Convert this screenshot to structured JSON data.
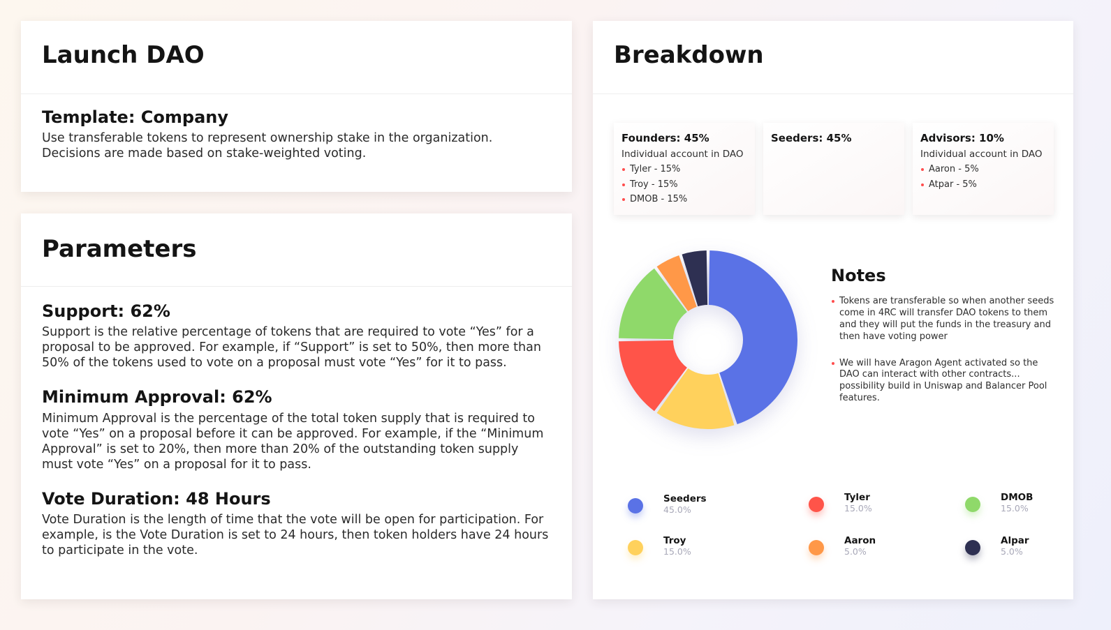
{
  "launch": {
    "title": "Launch DAO",
    "template_title": "Template: Company",
    "template_desc": "Use transferable tokens to represent ownership stake in the organization. Decisions are made based on stake-weighted voting."
  },
  "parameters": {
    "title": "Parameters",
    "items": [
      {
        "title": "Support: 62%",
        "desc": "Support is the relative percentage of tokens that are required to vote “Yes” for a proposal to be approved. For example, if “Support” is set to 50%, then more than 50% of the tokens used to vote on a proposal must vote “Yes” for it to pass."
      },
      {
        "title": "Minimum Approval: 62%",
        "desc": "Minimum Approval is the percentage of the total token supply that is required  to vote “Yes” on a proposal before it can be approved. For example, if the “Minimum Approval” is set to 20%, then more than 20% of the outstanding token supply must vote “Yes” on a proposal for it to pass."
      },
      {
        "title": "Vote Duration: 48 Hours",
        "desc": "Vote Duration is the length of time that the vote will be open for participation. For example, is the Vote Duration is set to 24 hours, then token holders have 24 hours to participate in the vote."
      }
    ]
  },
  "breakdown": {
    "title": "Breakdown",
    "allocations": [
      {
        "title": "Founders: 45%",
        "subtitle": "Individual account in DAO",
        "items": [
          "Tyler - 15%",
          "Troy - 15%",
          "DMOB - 15%"
        ]
      },
      {
        "title": "Seeders: 45%",
        "subtitle": "",
        "items": []
      },
      {
        "title": "Advisors: 10%",
        "subtitle": "Individual account in DAO",
        "items": [
          "Aaron - 5%",
          "Atpar - 5%"
        ]
      }
    ],
    "notes": {
      "title": "Notes",
      "items": [
        "Tokens are transferable so when another seeds come in 4RC will transfer DAO tokens to them and they will put the funds in the treasury and then have voting power",
        "We will have Aragon Agent activated so the DAO can interact with other contracts... possibility build in Uniswap and Balancer Pool features."
      ]
    },
    "legend": [
      {
        "name": "Seeders",
        "pct": "45.0%"
      },
      {
        "name": "Tyler",
        "pct": "15.0%"
      },
      {
        "name": "DMOB",
        "pct": "15.0%"
      },
      {
        "name": "Troy",
        "pct": "15.0%"
      },
      {
        "name": "Aaron",
        "pct": "5.0%"
      },
      {
        "name": "Alpar",
        "pct": "5.0%"
      }
    ]
  },
  "colors": {
    "bullet": "#ff4d4d",
    "legend_pct": "#a8a8b8"
  },
  "chart_data": {
    "type": "pie",
    "categories": [
      "Seeders",
      "Troy",
      "Tyler",
      "DMOB",
      "Aaron",
      "Alpar"
    ],
    "values": [
      45.0,
      15.0,
      15.0,
      15.0,
      5.0,
      5.0
    ],
    "colors": [
      "#5a72e6",
      "#ffd15c",
      "#ff5449",
      "#8fd96a",
      "#ff9848",
      "#2e3052"
    ],
    "donut": true
  }
}
